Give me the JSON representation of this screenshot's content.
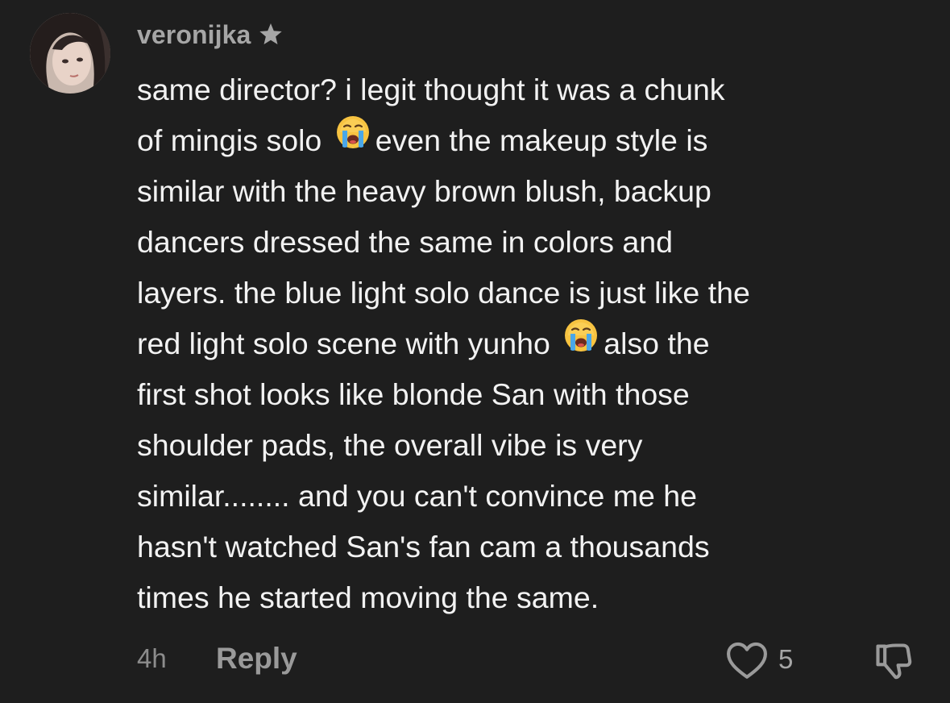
{
  "comment": {
    "username": "veronijka",
    "star_icon": "star-icon",
    "avatar_icon": "avatar-photo",
    "lines": [
      [
        "same director? i legit thought it was a chunk"
      ],
      [
        "of mingis solo ",
        "even the makeup style is"
      ],
      [
        "similar with the heavy brown blush, backup"
      ],
      [
        "dancers dressed the same in colors and"
      ],
      [
        "layers. the blue light solo dance is just like the"
      ],
      [
        "red light solo scene with yunho ",
        "also the"
      ],
      [
        "first shot looks like blonde San with those"
      ],
      [
        "shoulder pads, the overall vibe is very"
      ],
      [
        "similar........ and you can't convince me he"
      ],
      [
        "hasn't watched San's fan cam a thousands"
      ],
      [
        "times he started moving the same."
      ]
    ],
    "emoji_icon": "loudly-crying-face-emoji"
  },
  "footer": {
    "time": "4h",
    "reply_label": "Reply",
    "like_icon": "heart-outline-icon",
    "like_count": "5",
    "dislike_icon": "thumbs-down-icon"
  },
  "colors": {
    "background": "#1e1e1e",
    "text": "#f2f2f2",
    "username": "#a6a6a6",
    "muted": "#8c8c8c"
  }
}
